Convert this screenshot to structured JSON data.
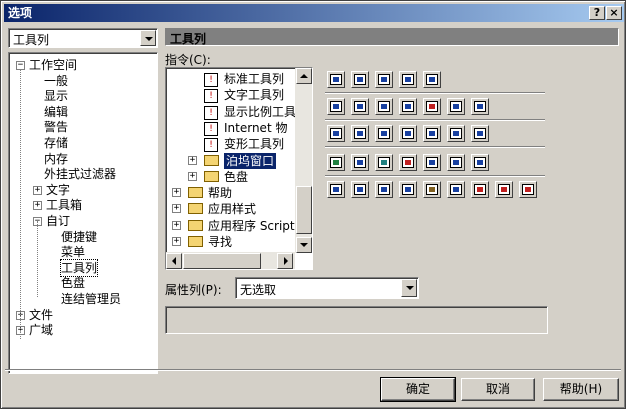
{
  "window": {
    "title": "选项",
    "help_btn": "?",
    "close_btn": "×"
  },
  "category_combo": {
    "value": "工具列"
  },
  "tree": [
    {
      "label": "工作空间",
      "toggle": "−"
    },
    {
      "label": "一般"
    },
    {
      "label": "显示"
    },
    {
      "label": "编辑"
    },
    {
      "label": "警告"
    },
    {
      "label": "存储"
    },
    {
      "label": "内存"
    },
    {
      "label": "外挂式过滤器"
    },
    {
      "label": "文字",
      "toggle": "+"
    },
    {
      "label": "工具箱",
      "toggle": "+"
    },
    {
      "label": "自订",
      "toggle": "−"
    },
    {
      "label": "便捷键"
    },
    {
      "label": "菜单"
    },
    {
      "label": "工具列",
      "selected": true
    },
    {
      "label": "色盘"
    },
    {
      "label": "连结管理员"
    },
    {
      "label": "文件",
      "toggle": "+"
    },
    {
      "label": "广域",
      "toggle": "+"
    }
  ],
  "section_title": "工具列",
  "commands_label": "指令(C):",
  "command_tree": [
    {
      "label": "标准工具列",
      "kind": "tb"
    },
    {
      "label": "文字工具列",
      "kind": "tb"
    },
    {
      "label": "显示比例工具",
      "kind": "tb"
    },
    {
      "label": "Internet 物",
      "kind": "tb"
    },
    {
      "label": "变形工具列",
      "kind": "tb"
    },
    {
      "label": "泊坞窗口",
      "kind": "folder",
      "toggle": "+",
      "selected": true
    },
    {
      "label": "色盘",
      "kind": "folder",
      "toggle": "+"
    },
    {
      "label": "帮助",
      "kind": "folder",
      "toggle": "+"
    },
    {
      "label": "应用样式",
      "kind": "folder",
      "toggle": "+"
    },
    {
      "label": "应用程序 Script",
      "kind": "folder",
      "toggle": "+"
    },
    {
      "label": "寻找",
      "kind": "folder",
      "toggle": "+"
    }
  ],
  "properties_label": "属性列(P):",
  "properties_combo": {
    "value": "无选取"
  },
  "buttons": {
    "ok": "确定",
    "cancel": "取消",
    "help": "帮助(H)"
  },
  "icon_rows": [
    {
      "colors": [
        "#1840a0",
        "#1840a0",
        "#1840a0",
        "#1840a0",
        "#1840a0"
      ]
    },
    {
      "colors": [
        "#1840a0",
        "#1840a0",
        "#1840a0",
        "#1840a0",
        "#c02020",
        "#1840a0",
        "#1840a0"
      ]
    },
    {
      "colors": [
        "#1840a0",
        "#1840a0",
        "#1840a0",
        "#1840a0",
        "#1840a0",
        "#1840a0",
        "#1840a0"
      ]
    },
    {
      "colors": [
        "#208040",
        "#1840a0",
        "#208080",
        "#c02020",
        "#1840a0",
        "#1840a0",
        "#1840a0"
      ]
    },
    {
      "colors": [
        "#1840a0",
        "#1840a0",
        "#1840a0",
        "#1840a0",
        "#806020",
        "#1840a0",
        "#c02020",
        "#c02020",
        "#c02020"
      ]
    }
  ]
}
